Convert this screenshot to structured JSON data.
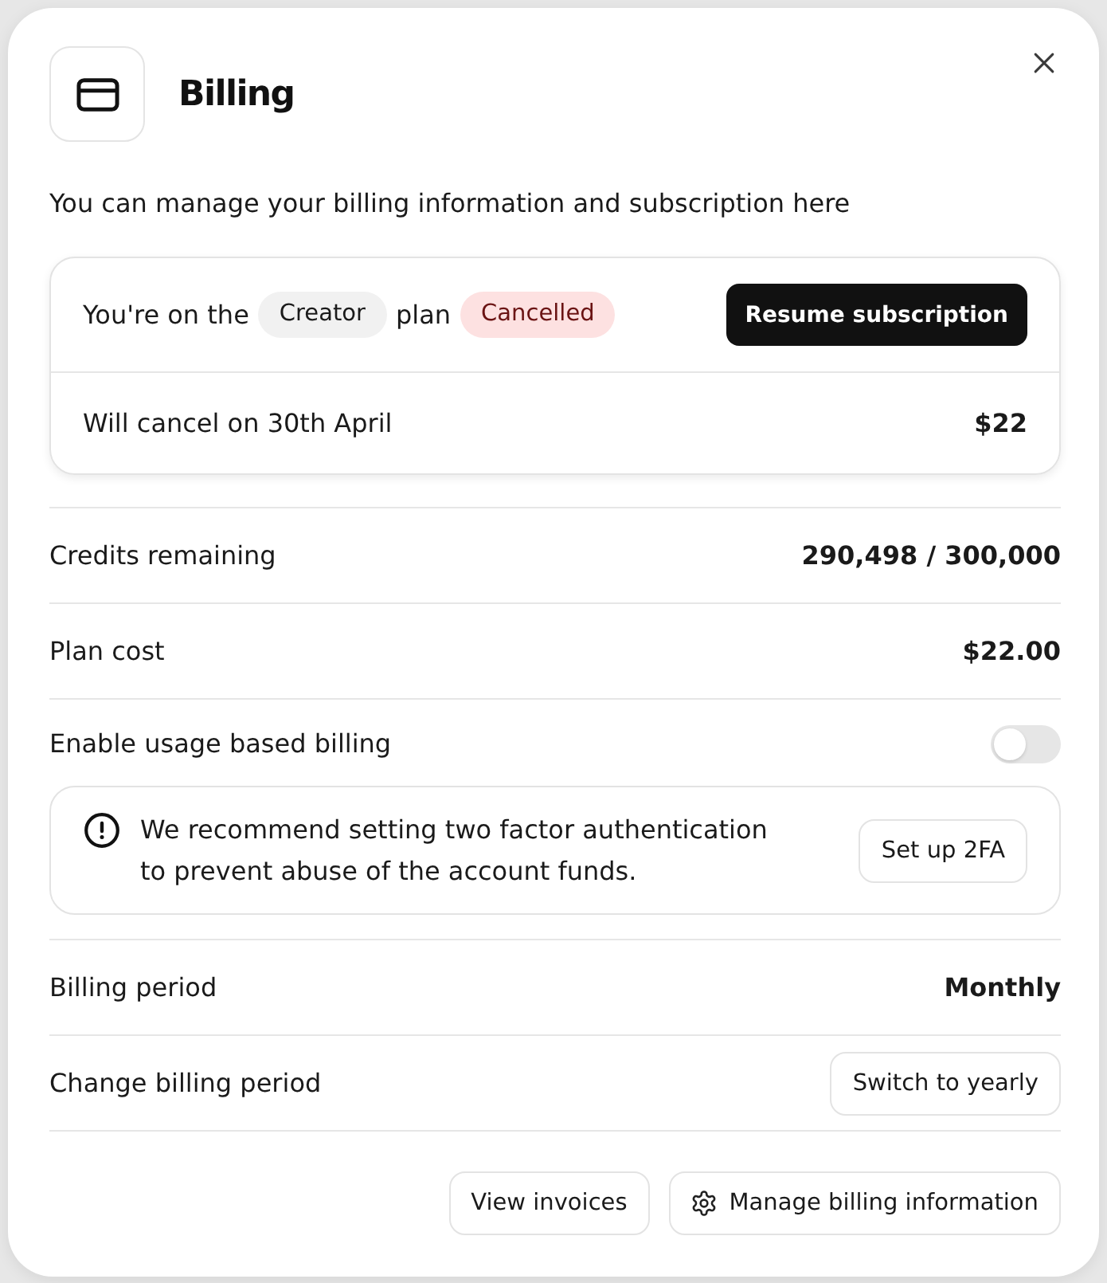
{
  "dialog": {
    "title": "Billing",
    "description": "You can manage your billing information and subscription here"
  },
  "plan_card": {
    "prefix": "You're on the",
    "plan": "Creator",
    "suffix": "plan",
    "status": {
      "label": "Cancelled",
      "kind": "cancelled"
    },
    "action": "Resume subscription",
    "note": "Will cancel on 30th April",
    "price": "$22"
  },
  "rows": [
    {
      "kind": "value",
      "label": "Credits remaining",
      "value": "290,498 / 300,000"
    },
    {
      "kind": "value",
      "label": "Plan cost",
      "value": "$22.00"
    },
    {
      "kind": "toggle",
      "label": "Enable usage based billing",
      "on": false
    },
    {
      "kind": "alert",
      "message": "We recommend setting two factor authentication to prevent abuse of the account funds.",
      "action": "Set up 2FA"
    },
    {
      "kind": "value",
      "label": "Billing period",
      "value": "Monthly"
    },
    {
      "kind": "button",
      "label": "Change billing period",
      "action": "Switch to yearly"
    }
  ],
  "footer_buttons": [
    {
      "kind": "plain",
      "label": "View invoices"
    },
    {
      "kind": "settings",
      "label": "Manage billing information"
    }
  ]
}
